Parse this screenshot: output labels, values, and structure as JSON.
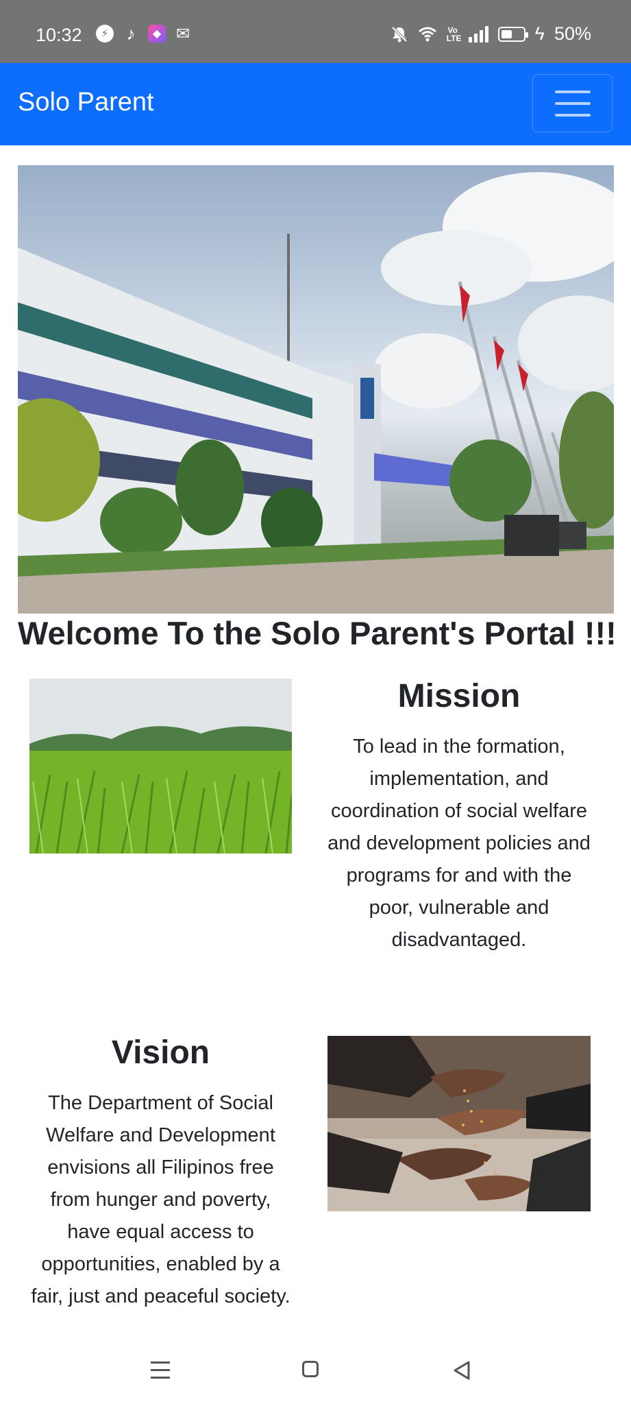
{
  "status_bar": {
    "time": "10:32",
    "battery_text": "50%",
    "battery_level": 0.5,
    "icons": [
      "messenger-icon",
      "tiktok-icon",
      "app-icon",
      "mail-icon",
      "mute-icon",
      "wifi-icon",
      "volte-icon",
      "signal-icon",
      "battery-icon",
      "charging-icon"
    ],
    "volte_label": "Vo LTE"
  },
  "navbar": {
    "brand": "Solo Parent",
    "toggle_icon": "hamburger-menu-icon",
    "color": "#0d6efd"
  },
  "hero": {
    "image": "government-building-photo"
  },
  "welcome": "Welcome To the Solo Parent's Portal !!!",
  "mission": {
    "title": "Mission",
    "text": "To lead in the formation, implementation, and coordination of social welfare and development policies and programs for and with the poor, vulnerable and disadvantaged.",
    "image": "rice-field-photo"
  },
  "vision": {
    "title": "Vision",
    "text": "The Department of Social Welfare and Development envisions all Filipinos free from hunger and poverty, have equal access to opportunities, enabled by a fair, just and peaceful society.",
    "image": "hands-sharing-grain-photo"
  },
  "system_nav": {
    "icons": [
      "recents-icon",
      "home-icon",
      "back-icon"
    ]
  }
}
